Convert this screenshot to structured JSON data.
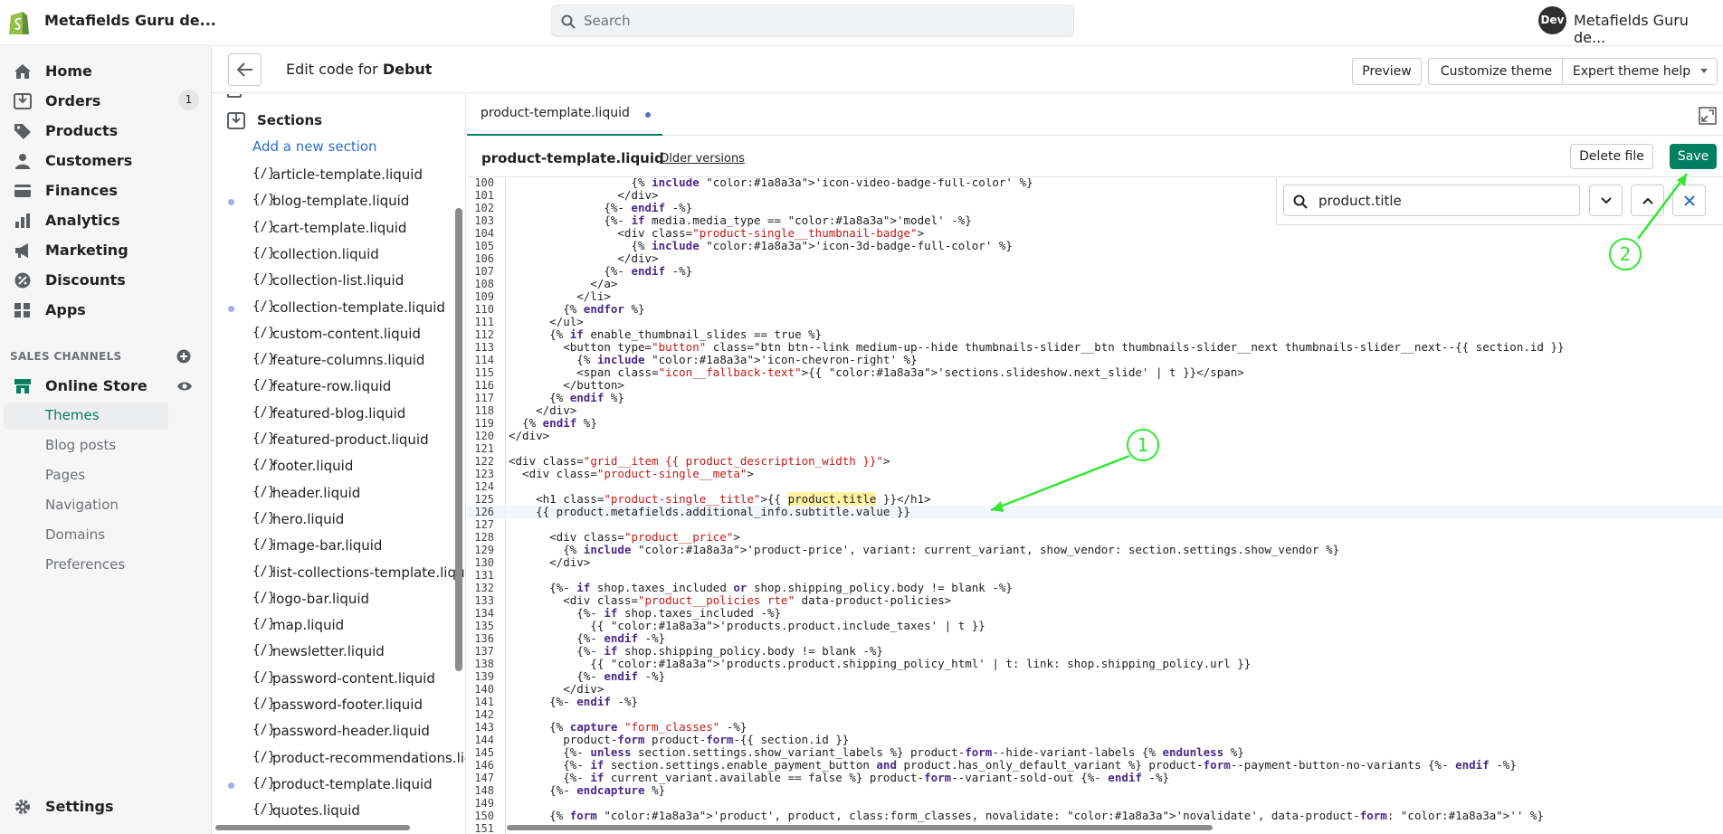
{
  "topbar": {
    "store_name": "Metafields Guru de...",
    "search_placeholder": "Search",
    "avatar_initials": "Dev",
    "account_name": "Metafields Guru de..."
  },
  "nav": {
    "items": [
      {
        "label": "Home",
        "icon": "home-icon"
      },
      {
        "label": "Orders",
        "icon": "orders-icon",
        "badge": "1"
      },
      {
        "label": "Products",
        "icon": "tag-icon"
      },
      {
        "label": "Customers",
        "icon": "person-icon"
      },
      {
        "label": "Finances",
        "icon": "finances-icon"
      },
      {
        "label": "Analytics",
        "icon": "bar-chart-icon"
      },
      {
        "label": "Marketing",
        "icon": "megaphone-icon"
      },
      {
        "label": "Discounts",
        "icon": "discount-icon"
      },
      {
        "label": "Apps",
        "icon": "apps-grid-icon"
      }
    ],
    "sales_channels_heading": "SALES CHANNELS",
    "online_store_label": "Online Store",
    "sub_items": [
      "Themes",
      "Blog posts",
      "Pages",
      "Navigation",
      "Domains",
      "Preferences"
    ],
    "settings_label": "Settings"
  },
  "editor_header": {
    "title_prefix": "Edit code for ",
    "theme_name": "Debut",
    "preview_label": "Preview",
    "customize_label": "Customize theme",
    "expert_help_label": "Expert theme help"
  },
  "filetree": {
    "sections_label": "Sections",
    "add_section_label": "Add a new section",
    "files": [
      {
        "name": "article-template.liquid",
        "modified": false
      },
      {
        "name": "blog-template.liquid",
        "modified": true
      },
      {
        "name": "cart-template.liquid",
        "modified": false
      },
      {
        "name": "collection.liquid",
        "modified": false
      },
      {
        "name": "collection-list.liquid",
        "modified": false
      },
      {
        "name": "collection-template.liquid",
        "modified": true
      },
      {
        "name": "custom-content.liquid",
        "modified": false
      },
      {
        "name": "feature-columns.liquid",
        "modified": false
      },
      {
        "name": "feature-row.liquid",
        "modified": false
      },
      {
        "name": "featured-blog.liquid",
        "modified": false
      },
      {
        "name": "featured-product.liquid",
        "modified": false
      },
      {
        "name": "footer.liquid",
        "modified": false
      },
      {
        "name": "header.liquid",
        "modified": false
      },
      {
        "name": "hero.liquid",
        "modified": false
      },
      {
        "name": "image-bar.liquid",
        "modified": false
      },
      {
        "name": "list-collections-template.liquid",
        "modified": false
      },
      {
        "name": "logo-bar.liquid",
        "modified": false
      },
      {
        "name": "map.liquid",
        "modified": false
      },
      {
        "name": "newsletter.liquid",
        "modified": false
      },
      {
        "name": "password-content.liquid",
        "modified": false
      },
      {
        "name": "password-footer.liquid",
        "modified": false
      },
      {
        "name": "password-header.liquid",
        "modified": false
      },
      {
        "name": "product-recommendations.liquid",
        "modified": false
      },
      {
        "name": "product-template.liquid",
        "modified": true
      },
      {
        "name": "quotes.liquid",
        "modified": false
      }
    ],
    "file_icon_glyph": "{/}"
  },
  "editor": {
    "tab_label": "product-template.liquid",
    "file_title": "product-template.liquid",
    "older_versions_label": "Older versions",
    "delete_label": "Delete file",
    "save_label": "Save",
    "find_value": "product.title",
    "code_lines": [
      {
        "n": "100",
        "t": "                  {% include 'icon-video-badge-full-color' %}"
      },
      {
        "n": "101",
        "t": "                </div>"
      },
      {
        "n": "102",
        "t": "              {%- endif -%}"
      },
      {
        "n": "103",
        "t": "              {%- if media.media_type == 'model' -%}"
      },
      {
        "n": "104",
        "t": "                <div class=\"product-single__thumbnail-badge\">"
      },
      {
        "n": "105",
        "t": "                  {% include 'icon-3d-badge-full-color' %}"
      },
      {
        "n": "106",
        "t": "                </div>"
      },
      {
        "n": "107",
        "t": "              {%- endif -%}"
      },
      {
        "n": "108",
        "t": "            </a>"
      },
      {
        "n": "109",
        "t": "          </li>"
      },
      {
        "n": "110",
        "t": "        {% endfor %}"
      },
      {
        "n": "111",
        "t": "      </ul>"
      },
      {
        "n": "112",
        "t": "      {% if enable_thumbnail_slides == true %}"
      },
      {
        "n": "113",
        "t": "        <button type=\"button\" class=\"btn btn--link medium-up--hide thumbnails-slider__btn thumbnails-slider__next thumbnails-slider__next--{{ section.id }}"
      },
      {
        "n": "114",
        "t": "          {% include 'icon-chevron-right' %}"
      },
      {
        "n": "115",
        "t": "          <span class=\"icon__fallback-text\">{{ 'sections.slideshow.next_slide' | t }}</span>"
      },
      {
        "n": "116",
        "t": "        </button>"
      },
      {
        "n": "117",
        "t": "      {% endif %}"
      },
      {
        "n": "118",
        "t": "    </div>"
      },
      {
        "n": "119",
        "t": "  {% endif %}"
      },
      {
        "n": "120",
        "t": "</div>"
      },
      {
        "n": "121",
        "t": ""
      },
      {
        "n": "122",
        "t": "<div class=\"grid__item {{ product_description_width }}\">"
      },
      {
        "n": "123",
        "t": "  <div class=\"product-single__meta\">"
      },
      {
        "n": "124",
        "t": ""
      },
      {
        "n": "125",
        "t": "    <h1 class=\"product-single__title\">{{ product.title }}</h1>"
      },
      {
        "n": "126",
        "t": "    {{ product.metafields.additional_info.subtitle.value }}"
      },
      {
        "n": "127",
        "t": ""
      },
      {
        "n": "128",
        "t": "      <div class=\"product__price\">"
      },
      {
        "n": "129",
        "t": "        {% include 'product-price', variant: current_variant, show_vendor: section.settings.show_vendor %}"
      },
      {
        "n": "130",
        "t": "      </div>"
      },
      {
        "n": "131",
        "t": ""
      },
      {
        "n": "132",
        "t": "      {%- if shop.taxes_included or shop.shipping_policy.body != blank -%}"
      },
      {
        "n": "133",
        "t": "        <div class=\"product__policies rte\" data-product-policies>"
      },
      {
        "n": "134",
        "t": "          {%- if shop.taxes_included -%}"
      },
      {
        "n": "135",
        "t": "            {{ 'products.product.include_taxes' | t }}"
      },
      {
        "n": "136",
        "t": "          {%- endif -%}"
      },
      {
        "n": "137",
        "t": "          {%- if shop.shipping_policy.body != blank -%}"
      },
      {
        "n": "138",
        "t": "            {{ 'products.product.shipping_policy_html' | t: link: shop.shipping_policy.url }}"
      },
      {
        "n": "139",
        "t": "          {%- endif -%}"
      },
      {
        "n": "140",
        "t": "        </div>"
      },
      {
        "n": "141",
        "t": "      {%- endif -%}"
      },
      {
        "n": "142",
        "t": ""
      },
      {
        "n": "143",
        "t": "      {% capture \"form_classes\" -%}"
      },
      {
        "n": "144",
        "t": "        product-form product-form-{{ section.id }}"
      },
      {
        "n": "145",
        "t": "        {%- unless section.settings.show_variant_labels %} product-form--hide-variant-labels {% endunless %}"
      },
      {
        "n": "146",
        "t": "        {%- if section.settings.enable_payment_button and product.has_only_default_variant %} product-form--payment-button-no-variants {%- endif -%}"
      },
      {
        "n": "147",
        "t": "        {%- if current_variant.available == false %} product-form--variant-sold-out {%- endif -%}"
      },
      {
        "n": "148",
        "t": "      {%- endcapture %}"
      },
      {
        "n": "149",
        "t": ""
      },
      {
        "n": "150",
        "t": "      {% form 'product', product, class:form_classes, novalidate: 'novalidate', data-product-form: '' %}"
      },
      {
        "n": "151",
        "t": ""
      }
    ]
  },
  "annotations": {
    "callout_1": "1",
    "callout_2": "2",
    "color": "#32e632"
  },
  "colors": {
    "accent": "#008060",
    "link": "#2c6ecb",
    "modified_dot": "#a4aee8"
  }
}
